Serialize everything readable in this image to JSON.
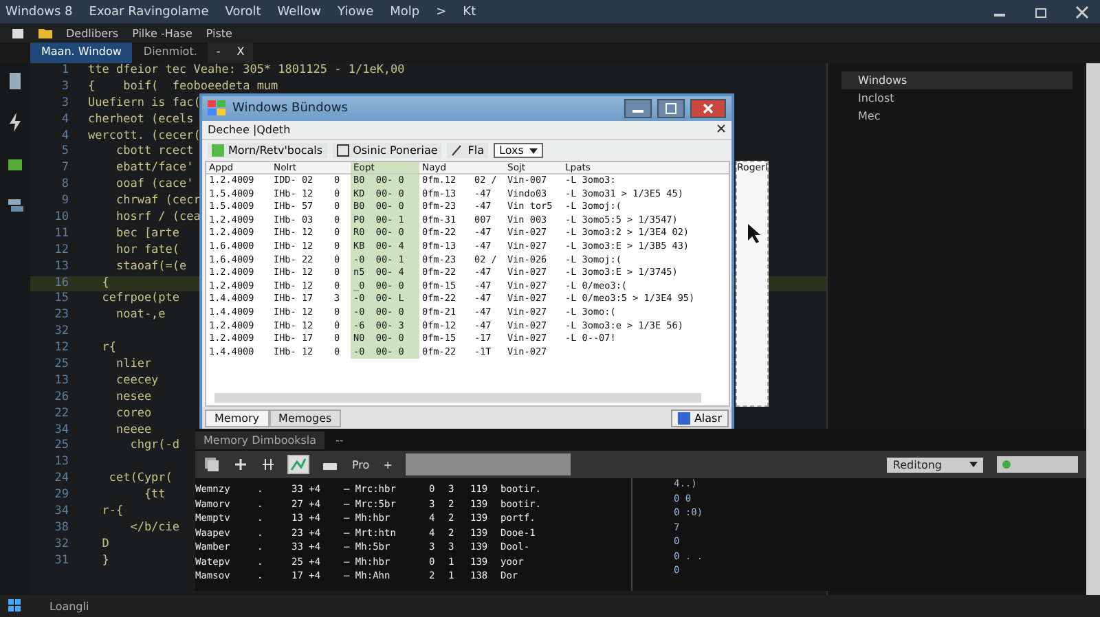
{
  "ide": {
    "menu": [
      "Windows 8",
      "Exoar Ravingolame",
      "Vorolt",
      "Wellow",
      "Yiowe",
      "Molp",
      ">",
      "Kt"
    ],
    "toolbar": [
      "Dedlibers",
      "Pilke -Hase",
      "Piste"
    ],
    "tabs": [
      {
        "label": "Maan. Window",
        "selected": true
      },
      {
        "label": "Dienmiot.",
        "selected": false
      }
    ],
    "tab_actions": [
      "-",
      "X"
    ],
    "code_lines": [
      {
        "number": "1",
        "text": "tte dfeior tec Veahe: 305* 1801125 - 1/1eK,00",
        "selected": false
      },
      {
        "number": "3",
        "text": "{    boif(  feoboeedeta mum",
        "selected": false
      },
      {
        "number": "3",
        "text": "Uuefiern is fac(",
        "selected": false
      },
      {
        "number": "4",
        "text": "cherheot (ecels",
        "selected": false
      },
      {
        "number": "4",
        "text": "wercott. (cecer(",
        "selected": false
      },
      {
        "number": "5",
        "text": "    cbott rcect",
        "selected": false
      },
      {
        "number": "7",
        "text": "    ebatt/face'",
        "selected": false
      },
      {
        "number": "8",
        "text": "    ooaf (cace'",
        "selected": false
      },
      {
        "number": "9",
        "text": "    chrwaf (cecr",
        "selected": false
      },
      {
        "number": "10",
        "text": "    hosrf / (cea",
        "selected": false
      },
      {
        "number": "11",
        "text": "    bec [arte",
        "selected": false
      },
      {
        "number": "12",
        "text": "    hor fate(",
        "selected": false
      },
      {
        "number": "13",
        "text": "    staoaf(=(e",
        "selected": false
      },
      {
        "number": "16",
        "text": "  {",
        "selected": true
      },
      {
        "number": "15",
        "text": "  cefrpoe(pte",
        "selected": false
      },
      {
        "number": "23",
        "text": "    noat-,e",
        "selected": false
      },
      {
        "number": "32",
        "selected": false
      },
      {
        "number": "12",
        "text": "  r{",
        "selected": false
      },
      {
        "number": "25",
        "text": "    nlier",
        "selected": false
      },
      {
        "number": "13",
        "text": "    ceecey",
        "selected": false
      },
      {
        "number": "26",
        "text": "    nesee",
        "selected": false
      },
      {
        "number": "22",
        "text": "    coreo",
        "selected": false
      },
      {
        "number": "34",
        "text": "    neeee",
        "selected": false
      },
      {
        "number": "25",
        "text": "      chgr(-d",
        "selected": false
      },
      {
        "number": "13",
        "selected": false
      },
      {
        "number": "24",
        "text": "   cet(Cypr(",
        "selected": false
      },
      {
        "number": "29",
        "text": "        {tt",
        "selected": false
      },
      {
        "number": "34",
        "text": "  r-{",
        "selected": false
      },
      {
        "number": "38",
        "text": "      </b/cie",
        "selected": false
      },
      {
        "number": "32",
        "text": "  D",
        "selected": false
      },
      {
        "number": "31",
        "text": "  }",
        "selected": false
      }
    ],
    "side_panel": [
      {
        "label": "Windows",
        "selected": true
      },
      {
        "label": "Inclost",
        "selected": false
      },
      {
        "label": "Mec",
        "selected": false
      }
    ],
    "status": "Loangli"
  },
  "dialog": {
    "title": "Windows Bündows",
    "menu": "Dechee |Qdeth",
    "toolbar": [
      "Morn/Retv'bocals",
      "Osinic Poneriae",
      "Fla"
    ],
    "combo": "Loxs",
    "columns": [
      {
        "label": "Appd",
        "selected": false
      },
      {
        "label": "Nolrt",
        "selected": false
      },
      {
        "selected": false
      },
      {
        "label": "Eopt",
        "selected": true
      },
      {
        "label": "Nayd",
        "selected": false
      },
      {
        "selected": false
      },
      {
        "label": "Sojt",
        "selected": false
      },
      {
        "label": "Lpats",
        "selected": false
      }
    ],
    "rows": [
      [
        "1.2.4009",
        "IDD- 02",
        "0",
        "B0  00- 0",
        "0fm.12",
        "02 /",
        "Vin-007",
        "-L 3omo3:"
      ],
      [
        "1.5.4009",
        "IHb- 12",
        "0",
        "KD  00- 0",
        "0fm-13",
        "-47",
        "Vindo03",
        "-L 3omo31 > 1/3E5 45)"
      ],
      [
        "1.5.4009",
        "IHb- 57",
        "0",
        "B0  00- 0",
        "0fm-23",
        "-47",
        "Vin tor5",
        "-L 3omoj:("
      ],
      [
        "1.2.4009",
        "IHb- 03",
        "0",
        "P0  00- 1",
        "0fm-31",
        "007",
        "Vin 003",
        "-L 3omo5:5 > 1/3547)"
      ],
      [
        "1.2.4009",
        "IHb- 12",
        "0",
        "R0  00- 0",
        "0fm-22",
        "-47",
        "Vin-027",
        "-L 3omo3:2 > 1/3E4 02)"
      ],
      [
        "1.6.4000",
        "IHb- 12",
        "0",
        "KB  00- 4",
        "0fm-13",
        "-47",
        "Vin-027",
        "-L 3omo3:E > 1/3B5 43)"
      ],
      [
        "1.6.4009",
        "IHb- 22",
        "0",
        "-0  00- 1",
        "0fm-23",
        "02 /",
        "Vin-026",
        "-L 3omoj:("
      ],
      [
        "1.2.4009",
        "IHb- 12",
        "0",
        "n5  00- 4",
        "0fm-22",
        "-47",
        "Vin-027",
        "-L 3omo3:E > 1/3745)"
      ],
      [
        "1.2.4009",
        "IHb- 12",
        "0",
        "_0  00- 0",
        "0fm-15",
        "-47",
        "Vin-027",
        "-L 0/meo3:("
      ],
      [
        "1.4.4009",
        "IHb- 17",
        "3",
        "-0  00- L",
        "0fm-22",
        "-47",
        "Vin-027",
        "-L 0/meo3:5 > 1/3E4 95)"
      ],
      [
        "1.4.4009",
        "IHb- 12",
        "0",
        "-0  00- 0",
        "0fm-21",
        "-47",
        "Vin-027",
        "-L 3omo:("
      ],
      [
        "1.2.4009",
        "IHb- 12",
        "0",
        "-6  00- 3",
        "0fm-12",
        "-47",
        "Vin-027",
        "-L 3omo3:e > 1/3E 56)"
      ],
      [
        "1.2.4009",
        "IHb- 17",
        "0",
        "N0  00- 0",
        "0fm-15",
        "-17",
        "Vin-027",
        "-L 0--07!"
      ],
      [
        "1.4.4000",
        "IHb- 12",
        "0",
        "-0  00- 0",
        "0fm-22",
        "-1T",
        "Vin-027"
      ]
    ],
    "right_title": "Rogerl",
    "bottom_tabs": [
      {
        "label": "Memory",
        "selected": true
      },
      {
        "label": "Memoges",
        "selected": false
      }
    ],
    "action": "Alasr"
  },
  "memory_panel": {
    "title": "Memory Dimbooksla",
    "title_action": "--",
    "tool_label": "Pro",
    "add": "+",
    "dropdown": "Reditong",
    "rows": [
      [
        "Wemnzy",
        ".",
        "33 +4",
        "— Mrc:hbr",
        "0",
        "3",
        "119",
        "bootir."
      ],
      [
        "Wamorv",
        ".",
        "27 +4",
        "— Mrc:5br",
        "3",
        "2",
        "139",
        "bootir."
      ],
      [
        "Memptv",
        ".",
        "13 +4",
        "— Mh:hbr",
        "4",
        "2",
        "139",
        "portf."
      ],
      [
        "Waapev",
        ".",
        "23 +4",
        "— Mrt:htn",
        "4",
        "2",
        "139",
        "Dooe-1"
      ],
      [
        "Wamber",
        ".",
        "33 +4",
        "— Mh:5br",
        "3",
        "3",
        "139",
        "Dool-"
      ],
      [
        "Watepv",
        ".",
        "25 +4",
        "— Mh:hbr",
        "0",
        "1",
        "139",
        "yoor"
      ],
      [
        "Mamsov",
        ".",
        "17 +4",
        "— Mh:Ahn",
        "2",
        "1",
        "138",
        "Dor"
      ]
    ],
    "side_values": [
      "4..)",
      "0  0",
      "0 :0)",
      "7",
      "0",
      "0 . .",
      "0"
    ]
  }
}
